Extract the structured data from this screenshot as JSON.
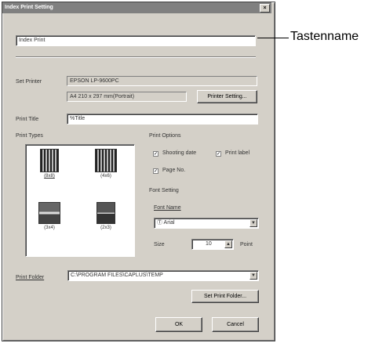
{
  "window": {
    "title": "Index Print Setting",
    "close_glyph": "×"
  },
  "key_name": {
    "value": "Index Print"
  },
  "callout": {
    "label": "Tastenname"
  },
  "printer": {
    "label": "Set Printer",
    "name": "EPSON LP-9600PC",
    "paper": "A4 210 x 297 mm(Portrait)",
    "setting_button": "Printer Setting..."
  },
  "print_title": {
    "label": "Print Title",
    "value": "%Title"
  },
  "print_types": {
    "label": "Print Types",
    "items": [
      {
        "caption": "(8x8)"
      },
      {
        "caption": "(4x6)"
      },
      {
        "caption": "(3x4)"
      },
      {
        "caption": "(2x3)"
      }
    ]
  },
  "print_options": {
    "label": "Print Options",
    "shooting_date": "Shooting date",
    "print_label": "Print label",
    "page_no": "Page No.",
    "checked_glyph": "✓"
  },
  "font_setting": {
    "label": "Font Setting",
    "font_name_label": "Font Name",
    "font_name_value": "Ⓣ Arial",
    "size_label": "Size",
    "size_value": "10",
    "size_unit": "Point"
  },
  "print_folder": {
    "label": "Print Folder",
    "value": "C:\\PROGRAM FILES\\CAPLUS\\TEMP",
    "set_button": "Set Print Folder..."
  },
  "buttons": {
    "ok": "OK",
    "cancel": "Cancel"
  },
  "icons": {
    "dropdown_arrow": "▼",
    "spin_arrow": "▲"
  }
}
